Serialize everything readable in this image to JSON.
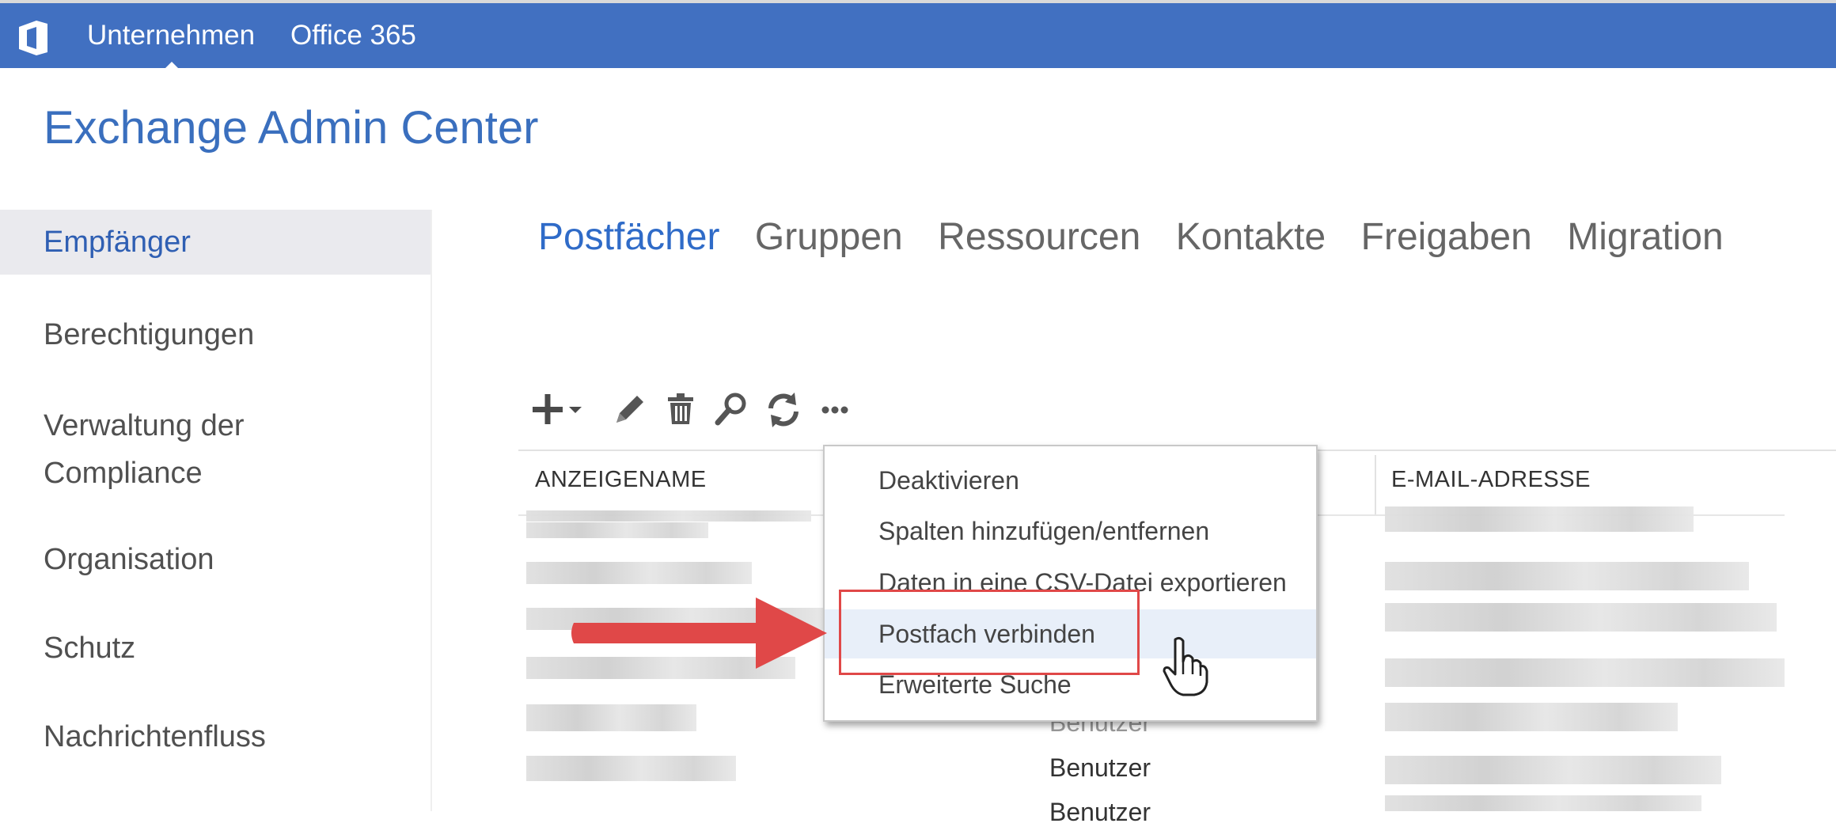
{
  "topbar": {
    "nav": [
      "Unternehmen",
      "Office 365"
    ],
    "brand_color": "#4170c1"
  },
  "page": {
    "title": "Exchange Admin Center"
  },
  "sidebar": {
    "items": [
      {
        "label": "Empfänger",
        "active": true
      },
      {
        "label": "Berechtigungen"
      },
      {
        "label": "Verwaltung der",
        "label2": "Compliance"
      },
      {
        "label": "Organisation"
      },
      {
        "label": "Schutz"
      },
      {
        "label": "Nachrichtenfluss"
      }
    ]
  },
  "tabs": [
    "Postfächer",
    "Gruppen",
    "Ressourcen",
    "Kontakte",
    "Freigaben",
    "Migration"
  ],
  "toolbar": {
    "icons": [
      "add-icon",
      "chevron-down-icon",
      "edit-icon",
      "delete-icon",
      "search-icon",
      "refresh-icon",
      "more-icon"
    ]
  },
  "grid": {
    "columns": [
      "ANZEIGENAME",
      "E-MAIL-ADRESSE"
    ],
    "visible_types": [
      "Benutzer",
      "Benutzer",
      "Benutzer"
    ]
  },
  "context_menu": {
    "items": [
      "Deaktivieren",
      "Spalten hinzufügen/entfernen",
      "Daten in eine CSV-Datei exportieren",
      "Postfach verbinden",
      "Erweiterte Suche"
    ],
    "hovered_index": 3
  },
  "annotation": {
    "arrow_color": "#e04848"
  }
}
